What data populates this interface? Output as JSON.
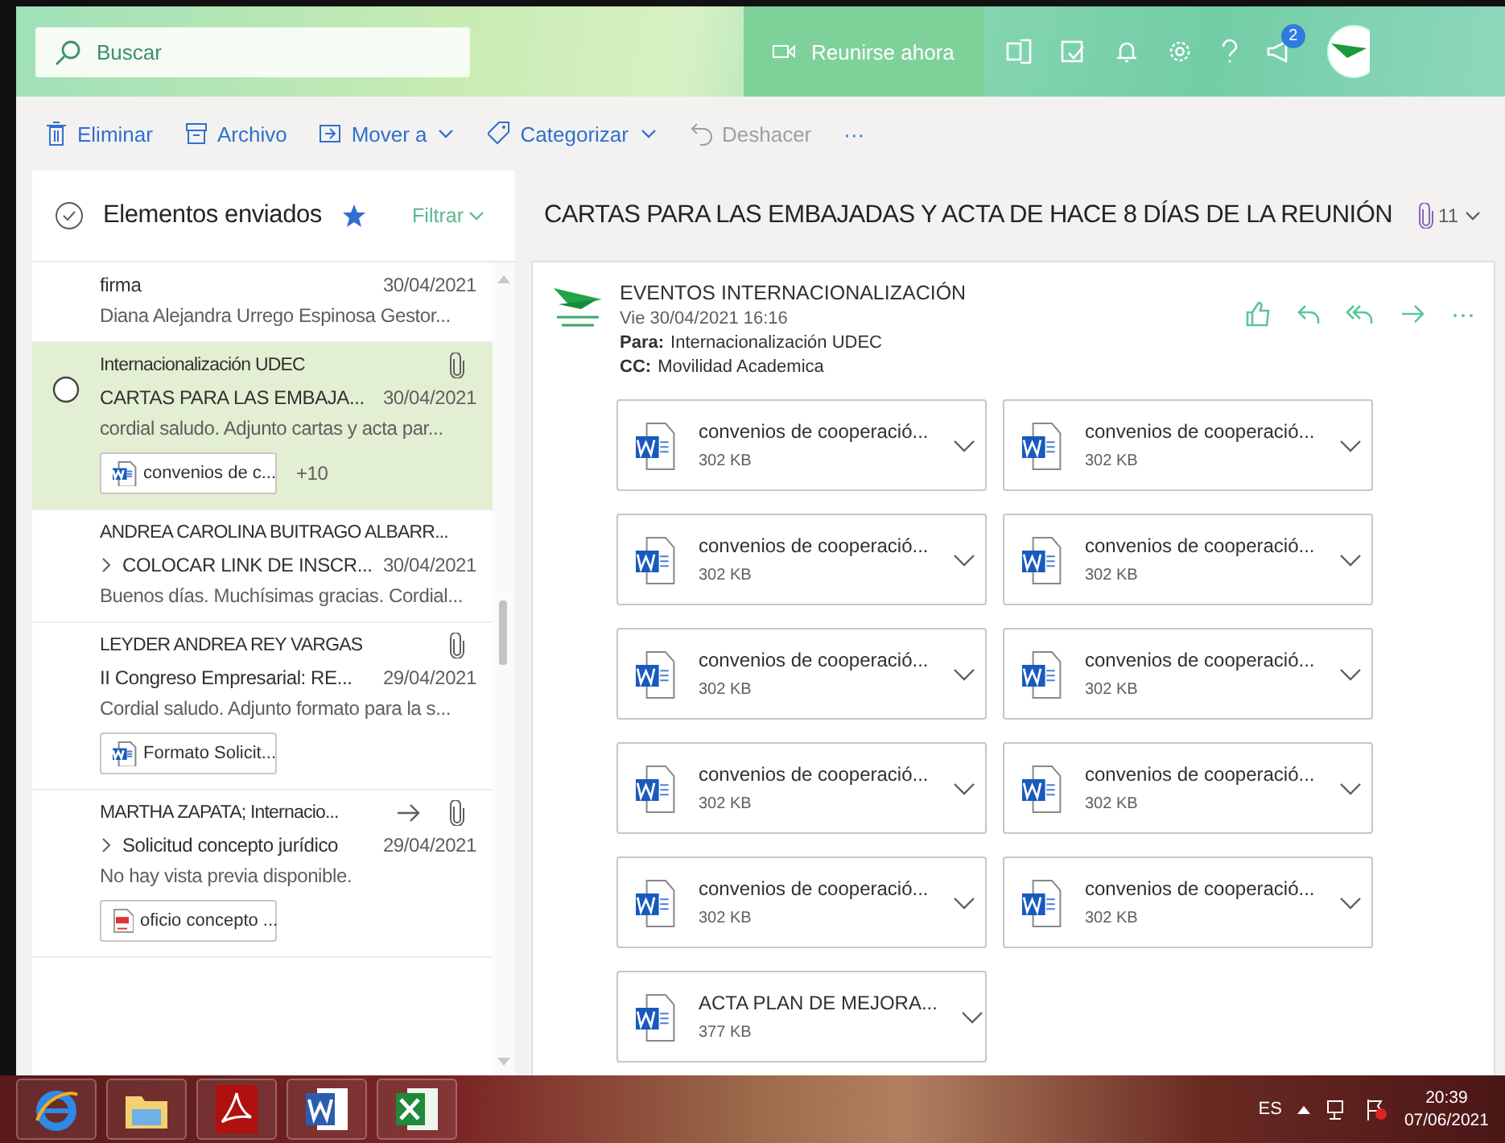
{
  "search": {
    "placeholder": "Buscar"
  },
  "header": {
    "meet_button": "Reunirse ahora",
    "notification_count": "2"
  },
  "toolbar": [
    {
      "label": "Eliminar",
      "kind": "delete",
      "disabled": false,
      "dropdown": false
    },
    {
      "label": "Archivo",
      "kind": "archive",
      "disabled": false,
      "dropdown": false
    },
    {
      "label": "Mover a",
      "kind": "move",
      "disabled": false,
      "dropdown": true
    },
    {
      "label": "Categorizar",
      "kind": "tag",
      "disabled": false,
      "dropdown": true
    },
    {
      "label": "Deshacer",
      "kind": "undo",
      "disabled": true,
      "dropdown": false
    }
  ],
  "toolbar_more": "···",
  "folder": {
    "title": "Elementos enviados",
    "favorite": true,
    "filter": "Filtrar"
  },
  "messages": [
    {
      "subject": "firma",
      "date": "30/04/2021",
      "preview": "Diana Alejandra Urrego Espinosa Gestor...",
      "selected": false,
      "thread": false
    },
    {
      "sender": "Internacionalización UDEC",
      "subject": "CARTAS PARA LAS EMBAJA...",
      "date": "30/04/2021",
      "preview": "cordial saludo. Adjunto cartas y acta par...",
      "selected": true,
      "attachment": true,
      "forwarded": false,
      "thread": false,
      "chip": {
        "label": "convenios de c...",
        "kind": "word"
      },
      "more": "+10"
    },
    {
      "sender": "ANDREA CAROLINA BUITRAGO ALBARR...",
      "subject": "COLOCAR LINK DE INSCR...",
      "date": "30/04/2021",
      "preview": "Buenos días. Muchísimas gracias. Cordial...",
      "selected": false,
      "attachment": false,
      "forwarded": false,
      "thread": true
    },
    {
      "sender": "LEYDER ANDREA REY VARGAS",
      "subject": "II Congreso Empresarial: RE...",
      "date": "29/04/2021",
      "preview": "Cordial saludo. Adjunto formato para la s...",
      "selected": false,
      "attachment": true,
      "forwarded": false,
      "thread": false,
      "chip": {
        "label": "Formato Solicit...",
        "kind": "word"
      }
    },
    {
      "sender": "MARTHA ZAPATA; Internacio...",
      "subject": "Solicitud concepto jurídico",
      "date": "29/04/2021",
      "preview": "No hay vista previa disponible.",
      "selected": false,
      "attachment": true,
      "forwarded": true,
      "thread": true,
      "chip": {
        "label": "oficio concepto ...",
        "kind": "pdf"
      }
    }
  ],
  "reading": {
    "subject": "CARTAS PARA LAS EMBAJADAS Y ACTA DE HACE 8 DÍAS DE LA REUNIÓN",
    "attachment_count": "11",
    "sender": "EVENTOS INTERNACIONALIZACIÓN",
    "datetime": "Vie 30/04/2021 16:16",
    "to_label": "Para:",
    "to": "Internacionalización UDEC",
    "cc_label": "CC:",
    "cc": "Movilidad Academica",
    "attachments": [
      {
        "name": "convenios de cooperació...",
        "size": "302 KB"
      },
      {
        "name": "convenios de cooperació...",
        "size": "302 KB"
      },
      {
        "name": "convenios de cooperació...",
        "size": "302 KB"
      },
      {
        "name": "convenios de cooperació...",
        "size": "302 KB"
      },
      {
        "name": "convenios de cooperació...",
        "size": "302 KB"
      },
      {
        "name": "convenios de cooperació...",
        "size": "302 KB"
      },
      {
        "name": "convenios de cooperació...",
        "size": "302 KB"
      },
      {
        "name": "convenios de cooperació...",
        "size": "302 KB"
      },
      {
        "name": "convenios de cooperació...",
        "size": "302 KB"
      },
      {
        "name": "convenios de cooperació...",
        "size": "302 KB"
      },
      {
        "name": "ACTA PLAN DE MEJORA...",
        "size": "377 KB"
      }
    ]
  },
  "taskbar": {
    "apps": [
      {
        "kind": "browser"
      },
      {
        "kind": "files"
      },
      {
        "kind": "pdf"
      },
      {
        "kind": "word"
      },
      {
        "kind": "excel"
      }
    ],
    "language": "ES",
    "time": "20:39",
    "date": "07/06/2021"
  }
}
